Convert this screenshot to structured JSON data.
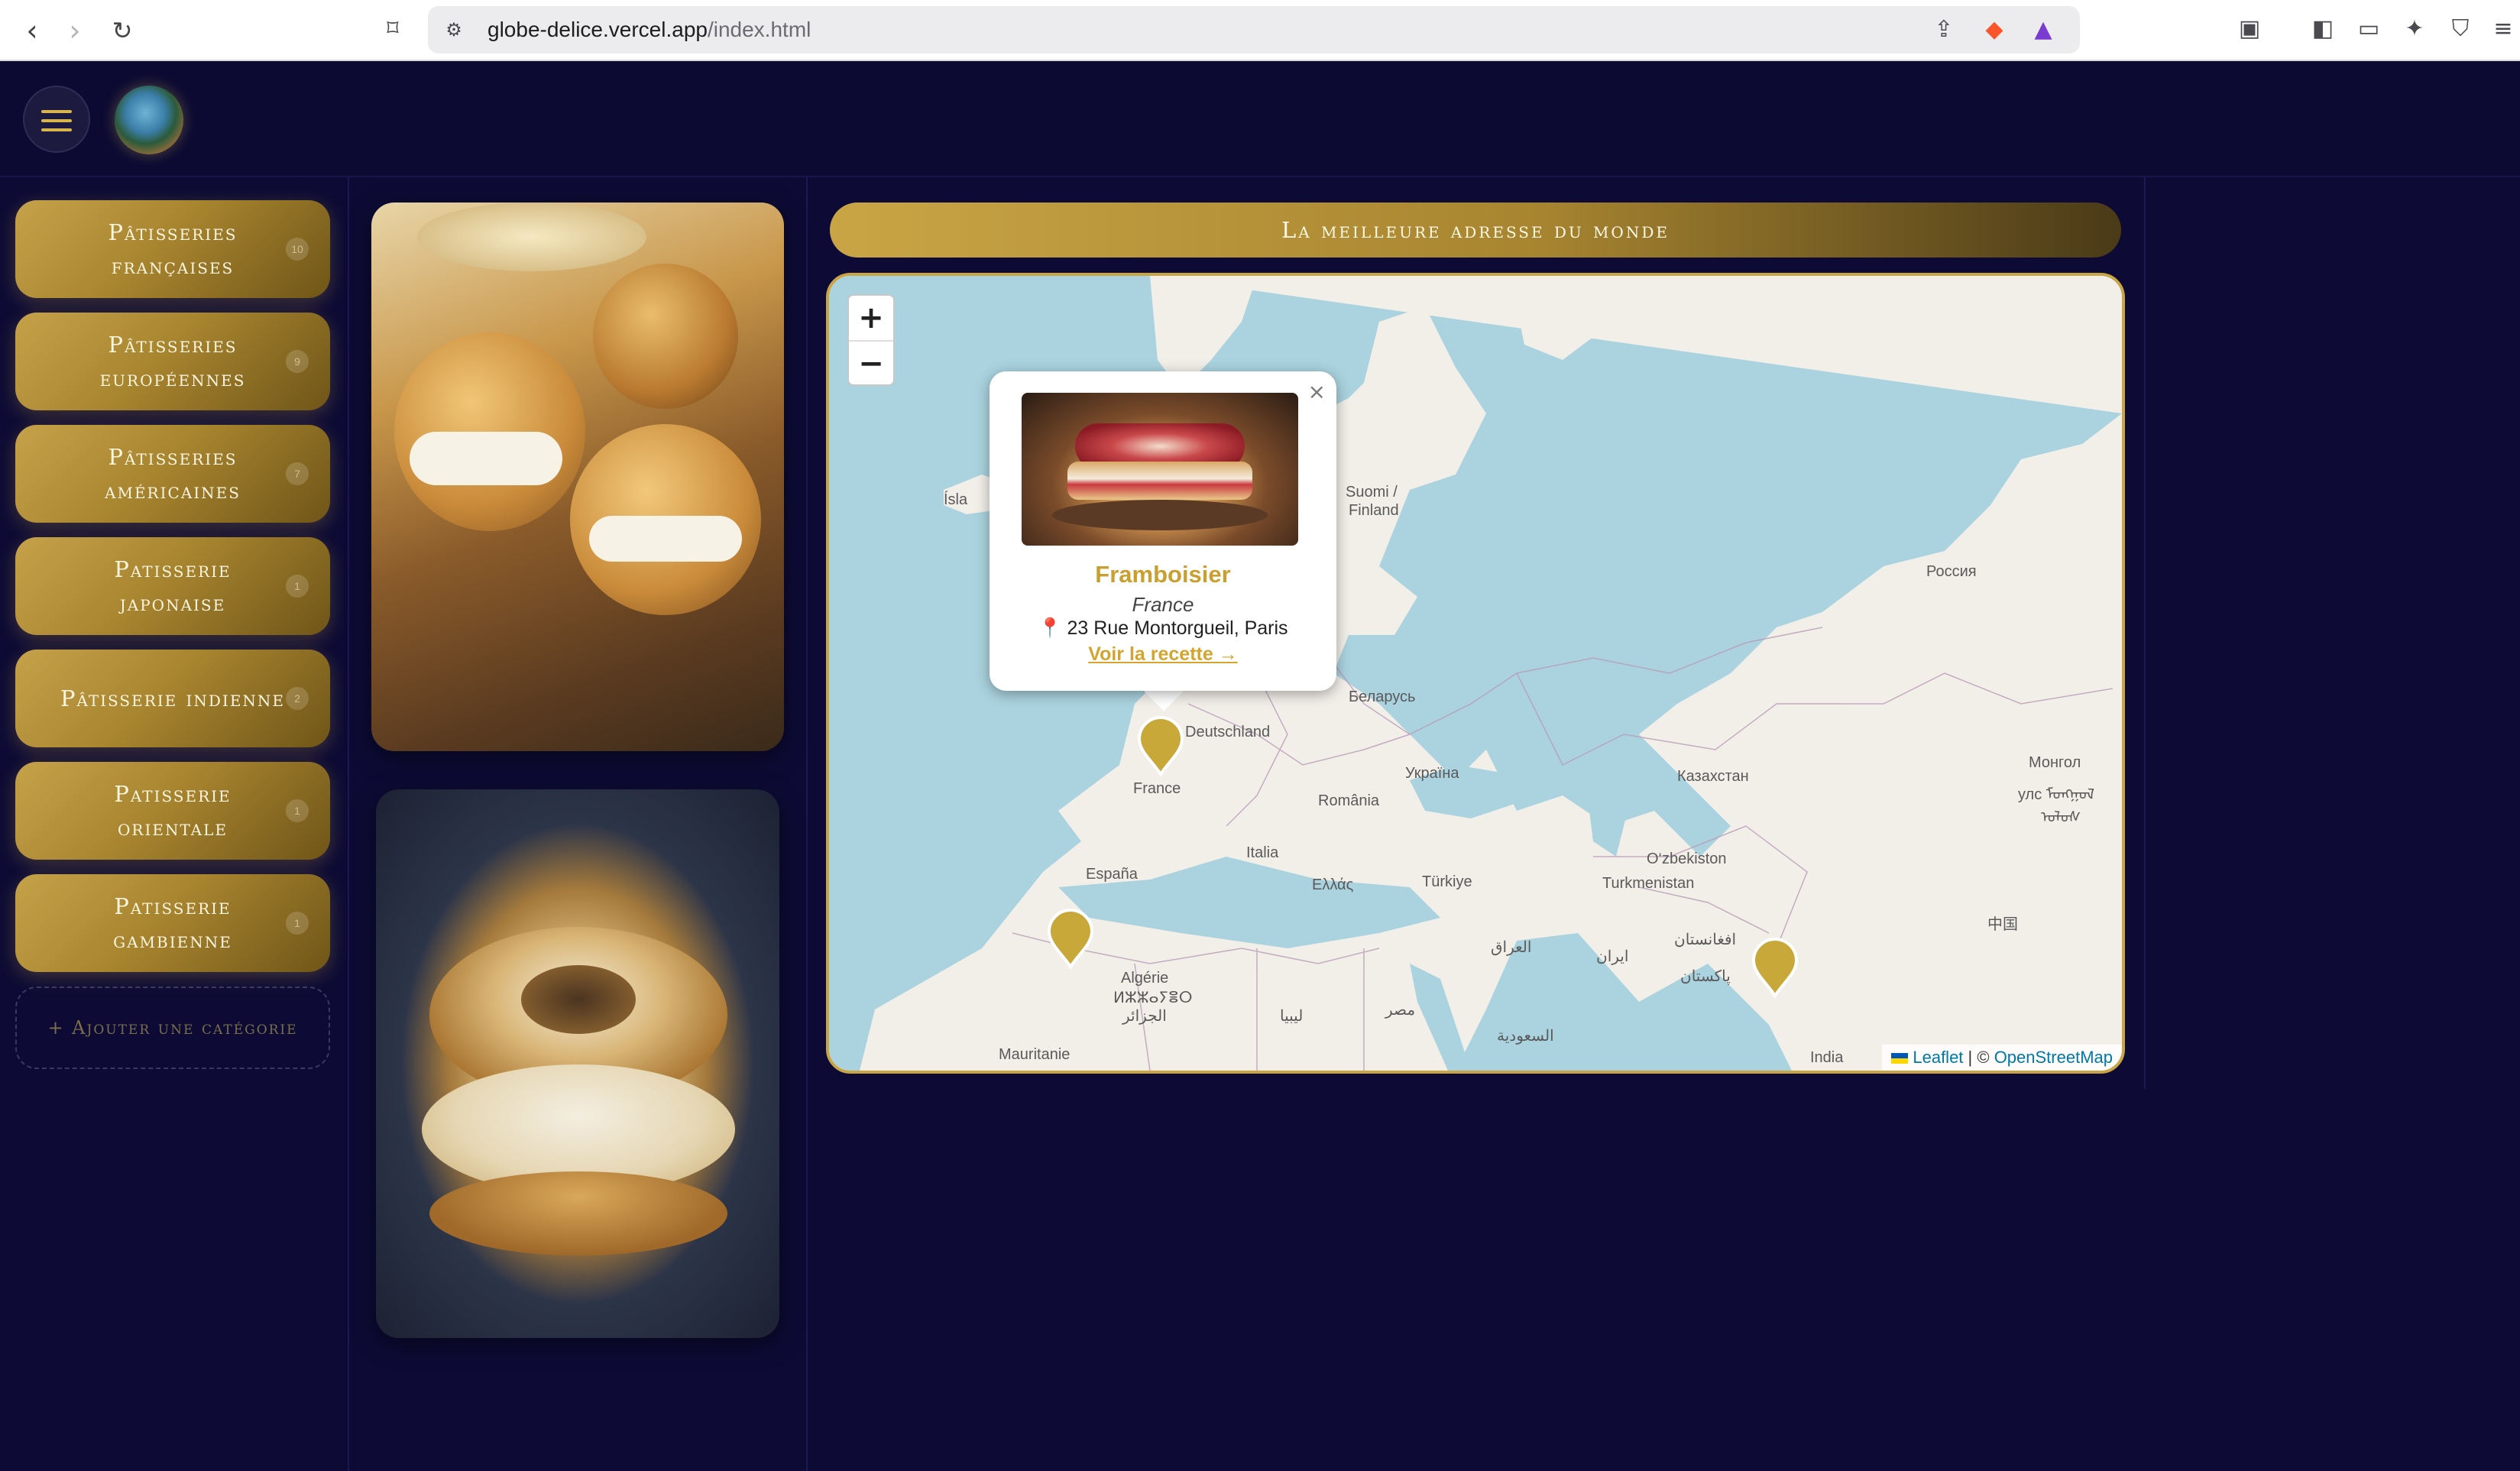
{
  "browser": {
    "url_domain": "globe-delice.vercel.app",
    "url_path": "/index.html"
  },
  "app": {
    "logo_name": "globe-delice-logo"
  },
  "sidebar": {
    "categories": [
      {
        "label": "Pâtisseries françaises",
        "count": "10"
      },
      {
        "label": "Pâtisseries européennes",
        "count": "9"
      },
      {
        "label": "Pâtisseries américaines",
        "count": "7"
      },
      {
        "label": "Patisserie japonaise",
        "count": "1"
      },
      {
        "label": "Pâtisserie indienne",
        "count": "2"
      },
      {
        "label": "Patisserie orientale",
        "count": "1"
      },
      {
        "label": "Patisserie gambienne",
        "count": "1"
      }
    ],
    "add_label": "+ Ajouter une catégorie"
  },
  "map": {
    "title": "La meilleure adresse du monde",
    "zoom_in": "+",
    "zoom_out": "−",
    "labels": {
      "island": "Ísla",
      "suomi": "Suomi /",
      "finland": "Finland",
      "russia": "Россия",
      "belarus": "Беларусь",
      "deutschland": "Deutschland",
      "france": "France",
      "ukraine": "Україна",
      "kazakhstan": "Казахстан",
      "mongolia1": "Монгол",
      "mongolia2": "улс ᠮᠣᠩᠭᠣᠯ",
      "mongolia3": "ᠤᠯᠤᠰ",
      "romania": "România",
      "espana": "España",
      "italia": "Italia",
      "ellas": "Ελλάς",
      "turkiye": "Türkiye",
      "ozbekiston": "O‘zbekiston",
      "turkmenistan": "Turkmenistan",
      "algerie1": "Algérie",
      "algerie2": "ⵍⵣⵣⴰⵢⴻⵔ",
      "algerie3": "الجزائر",
      "libya": "ليبيا",
      "misr": "مصر",
      "iraq": "العراق",
      "iran": "ایران",
      "afghanistan": "افغانستان",
      "pakistan": "پاکستان",
      "china": "中国",
      "saudi": "السعودية",
      "mauritanie": "Mauritanie",
      "india": "India"
    },
    "attribution": {
      "leaflet": "Leaflet",
      "separator": " | © ",
      "osm": "OpenStreetMap"
    },
    "popup": {
      "name": "Framboisier",
      "country": "France",
      "address": "📍 23 Rue Montorgueil, Paris",
      "link": "Voir la recette →",
      "close": "×"
    },
    "marker_color": "#c9a83a"
  },
  "colors": {
    "background": "#0d0b35",
    "accent_gold": "#c9a545"
  }
}
